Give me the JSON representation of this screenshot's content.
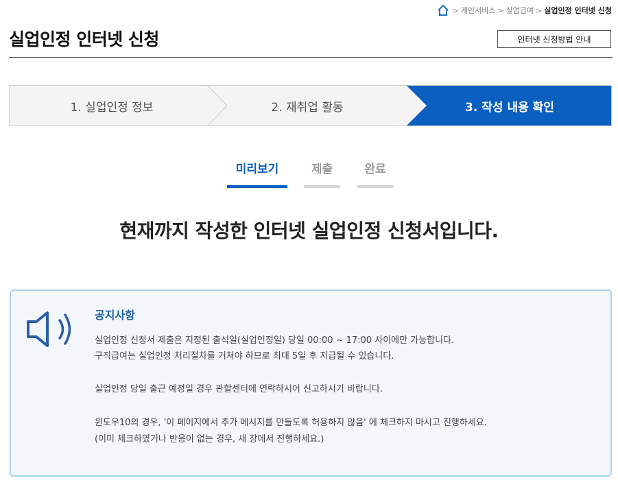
{
  "breadcrumb": {
    "items": [
      "개인서비스",
      "실업급여",
      "실업인정 인터넷 신청"
    ],
    "separator": ">"
  },
  "header": {
    "title": "실업인정 인터넷 신청",
    "guide_button": "인터넷 신청방법 안내"
  },
  "steps": [
    {
      "label": "1. 실업인정 정보",
      "active": false
    },
    {
      "label": "2. 재취업 활동",
      "active": false
    },
    {
      "label": "3. 작성 내용 확인",
      "active": true
    }
  ],
  "subtabs": [
    {
      "label": "미리보기",
      "active": true
    },
    {
      "label": "제출",
      "active": false
    },
    {
      "label": "완료",
      "active": false
    }
  ],
  "headline": "현재까지 작성한 인터넷 실업인정 신청서입니다.",
  "notice": {
    "title": "공지사항",
    "lines": [
      "실업인정 신청서 제출은 지정된 출석일(실업인정일) 당일 00:00 ~ 17:00 사이에만 가능합니다.",
      "구직급여는 실업인정 처리절차를 거쳐야 하므로 최대 5일 후 지급될 수 있습니다.",
      "실업인정 당일 출근 예정일 경우 관할센터에 연락하시어 신고하시기 바랍니다.",
      "윈도우10의 경우, '이 페이지에서 추가 메시지를 만들도록 허용하지 않음' 에 체크하지 마시고 진행하세요.",
      "(이미 체크하였거나 반응이 없는 경우, 새 창에서 진행하세요.)"
    ]
  },
  "colors": {
    "accent": "#0a5fc0",
    "step_inactive_bg": "#f4f4f4",
    "notice_bg": "#f3f7fc",
    "notice_border": "#a9d3e8",
    "notice_title": "#1d5ea8"
  },
  "icons": {
    "home": "home-icon",
    "speaker": "speaker-icon"
  }
}
